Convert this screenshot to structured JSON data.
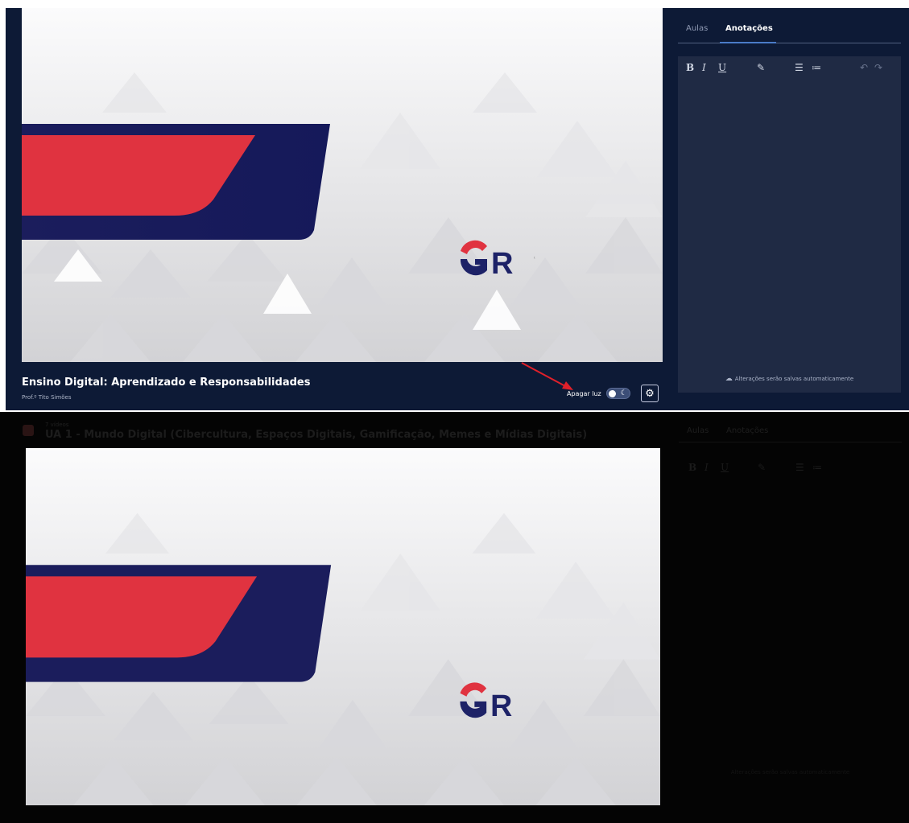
{
  "top": {
    "course_title": "Ensino Digital: Aprendizado e Responsabilidades",
    "professor": "Prof.º Tito Simões",
    "lights_label": "Apagar luz",
    "lights_toggle": "off",
    "logo_text": "GR",
    "tabs": [
      {
        "label": "Aulas",
        "active": false
      },
      {
        "label": "Anotações",
        "active": true
      }
    ],
    "toolbar": {
      "bold": "B",
      "italic": "I",
      "underline": "U",
      "highlight_icon": "pencil-icon",
      "bullet_list_icon": "bullet-list-icon",
      "numbered_list_icon": "numbered-list-icon",
      "undo_icon": "undo-icon",
      "redo_icon": "redo-icon"
    },
    "autosave_text": "Alterações serão salvas automaticamente"
  },
  "bottom": {
    "videos_label": "7 vídeos",
    "unit_title": "UA 1 - Mundo Digital (Cibercultura, Espaços Digitais, Gamificação, Memes e Mídias Digitais)",
    "logo_text": "GR",
    "tabs": [
      {
        "label": "Aulas"
      },
      {
        "label": "Anotações"
      }
    ],
    "toolbar": {
      "bold": "B",
      "italic": "I",
      "underline": "U"
    },
    "autosave_text": "Alterações serão salvas automaticamente"
  },
  "colors": {
    "navy": "#0d1a36",
    "panel": "#1f2a44",
    "brand_red": "#e03340",
    "brand_navy": "#1d2267",
    "annotation_arrow": "#e0202a"
  }
}
